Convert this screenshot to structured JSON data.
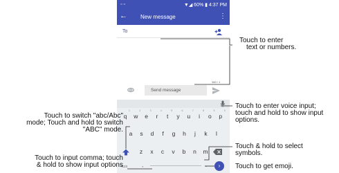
{
  "statusbar": {
    "left": "▫ ▫",
    "right": "▼◢ 60% ▮ 4:37 PM"
  },
  "appbar": {
    "back": "←",
    "title": "New message",
    "more": "⋮"
  },
  "to_field": {
    "label": "To"
  },
  "counter": "160 / 1",
  "compose": {
    "placeholder": "Send message"
  },
  "keyboard": {
    "row1": [
      {
        "k": "q",
        "n": "1"
      },
      {
        "k": "w",
        "n": "2"
      },
      {
        "k": "e",
        "n": "3"
      },
      {
        "k": "r",
        "n": "4"
      },
      {
        "k": "t",
        "n": "5"
      },
      {
        "k": "y",
        "n": "6"
      },
      {
        "k": "u",
        "n": "7"
      },
      {
        "k": "i",
        "n": "8"
      },
      {
        "k": "o",
        "n": "9"
      },
      {
        "k": "p",
        "n": "0"
      }
    ],
    "row2": [
      "a",
      "s",
      "d",
      "f",
      "g",
      "h",
      "j",
      "k",
      "l"
    ],
    "row3": [
      "z",
      "x",
      "c",
      "v",
      "b",
      "n",
      "m"
    ],
    "sym_label": "?123",
    "comma": ",",
    "period": "."
  },
  "annotations": {
    "enter_text": [
      "Touch to enter",
      "text or numbers."
    ],
    "voice_input": [
      "Touch to enter voice input;",
      "touch and hold to show input",
      "options."
    ],
    "switch_mode": [
      "Touch to switch  \"abc/Abc\"",
      "mode; Touch and hold to switch",
      "\"ABC\" mode."
    ],
    "select_symbols": [
      "Touch & hold to select",
      "symbols."
    ],
    "input_comma": [
      "Touch to input comma; touch",
      "& hold to show input options"
    ],
    "get_emoji": [
      "Touch to get emoji."
    ]
  },
  "colors": {
    "primary": "#3f51b5",
    "keyboard_bg": "#eceff1",
    "input_bg": "#e9e9e9"
  }
}
